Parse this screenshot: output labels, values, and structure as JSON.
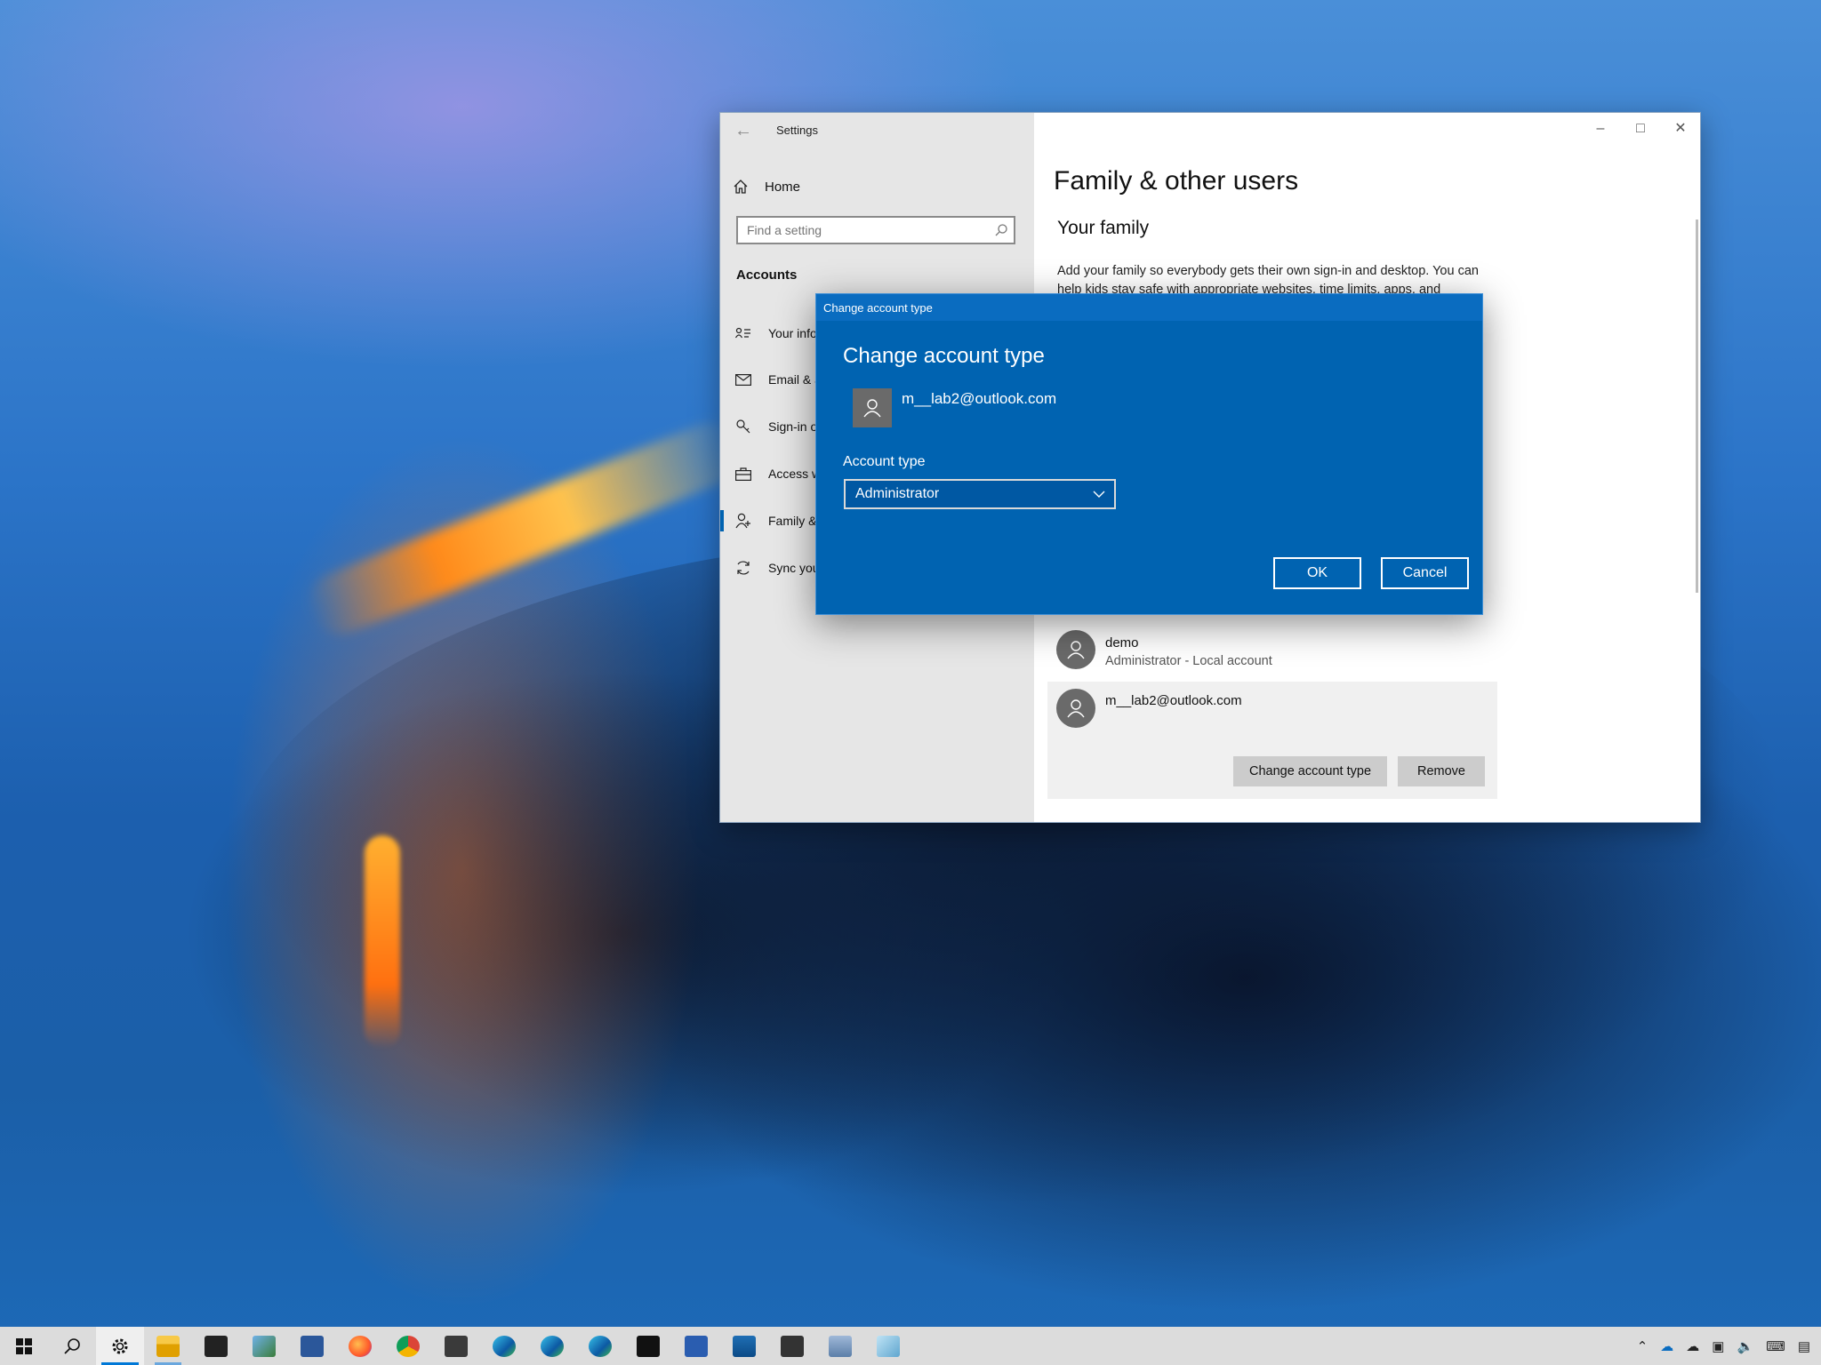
{
  "settings": {
    "window_title": "Settings",
    "home_label": "Home",
    "search_placeholder": "Find a setting",
    "section_heading": "Accounts",
    "nav_items": [
      {
        "label": "Your info",
        "icon": "person-card-icon"
      },
      {
        "label": "Email & accounts",
        "icon": "mail-icon"
      },
      {
        "label": "Sign-in options",
        "icon": "key-icon"
      },
      {
        "label": "Access work or school",
        "icon": "briefcase-icon"
      },
      {
        "label": "Family & other users",
        "icon": "person-add-icon",
        "active": true
      },
      {
        "label": "Sync your settings",
        "icon": "sync-icon"
      }
    ],
    "page_title": "Family & other users",
    "your_family_heading": "Your family",
    "family_description": "Add your family so everybody gets their own sign-in and desktop. You can help kids stay safe with appropriate websites, time limits, apps, and",
    "users": [
      {
        "name": "demo",
        "subtitle": "Administrator - Local account"
      },
      {
        "name": "m__lab2@outlook.com",
        "subtitle": ""
      }
    ],
    "change_account_type_button": "Change account type",
    "remove_button": "Remove"
  },
  "dialog": {
    "title_bar": "Change account type",
    "heading": "Change account type",
    "email": "m__lab2@outlook.com",
    "account_type_label": "Account type",
    "account_type_value": "Administrator",
    "ok_label": "OK",
    "cancel_label": "Cancel"
  },
  "colors": {
    "dialog_blue": "#0063b1",
    "accent": "#0078d7",
    "sidebar_grey": "#e6e6e6"
  },
  "taskbar": {
    "apps": [
      "start-icon",
      "search-icon",
      "settings-icon",
      "file-explorer-icon",
      "store-icon",
      "photos-icon",
      "word-icon",
      "firefox-icon",
      "chrome-icon",
      "terminal-icon",
      "edge-icon",
      "edge-beta-icon",
      "edge-dev-icon",
      "cmd-icon",
      "powershell-icon",
      "photos-app-icon",
      "app-icon",
      "network-icon",
      "notepad-icon"
    ]
  }
}
